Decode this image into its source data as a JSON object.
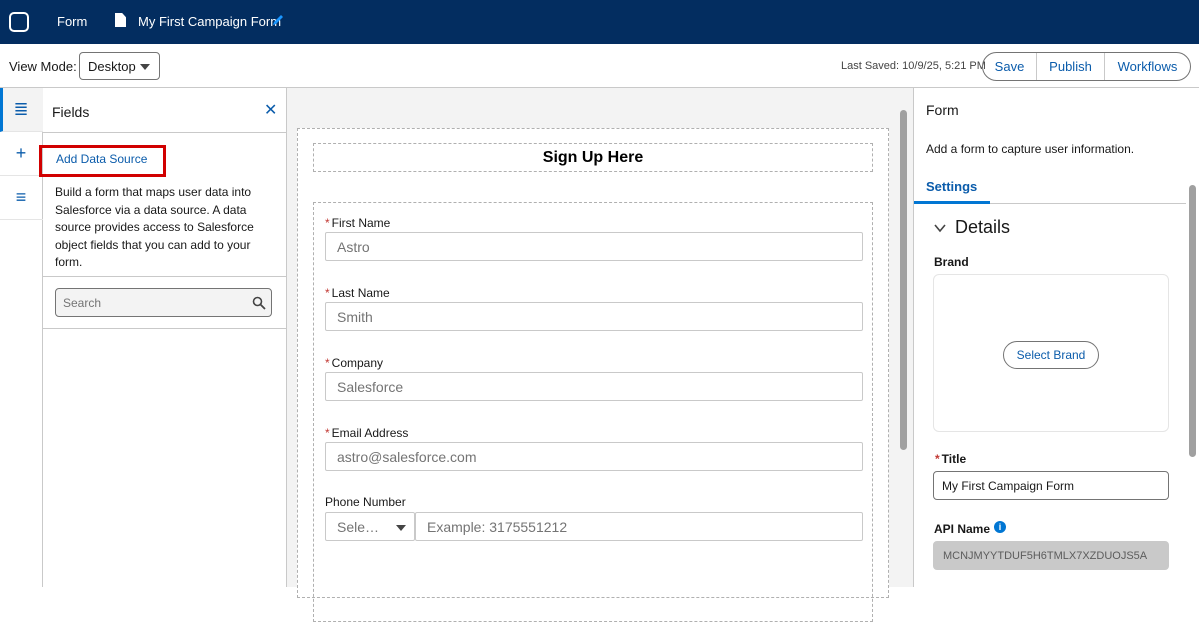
{
  "topbar": {
    "app_label": "Form",
    "form_title": "My First Campaign Form"
  },
  "toolbar": {
    "view_mode_label": "View Mode:",
    "view_mode_value": "Desktop",
    "last_saved": "Last Saved: 10/9/25, 5:21 PM",
    "save_label": "Save",
    "publish_label": "Publish",
    "workflows_label": "Workflows"
  },
  "rail": {
    "items": [
      {
        "icon": "fields-icon",
        "glyph": "≣"
      },
      {
        "icon": "add-icon",
        "glyph": "+"
      },
      {
        "icon": "list-icon",
        "glyph": "≡"
      }
    ]
  },
  "fields_panel": {
    "title": "Fields",
    "add_data_source": "Add Data Source",
    "description": "Build a form that maps user data into Salesforce via a data source. A data source provides access to Salesforce object fields that you can add to your form.",
    "search_placeholder": "Search"
  },
  "form": {
    "heading": "Sign Up Here",
    "fields": [
      {
        "label": "First Name",
        "required": "*",
        "placeholder": "Astro"
      },
      {
        "label": "Last Name",
        "required": "*",
        "placeholder": "Smith"
      },
      {
        "label": "Company",
        "required": "*",
        "placeholder": "Salesforce"
      },
      {
        "label": "Email Address",
        "required": "*",
        "placeholder": "astro@salesforce.com"
      }
    ],
    "phone": {
      "label": "Phone Number",
      "select_value": "Sele…",
      "placeholder": "Example: 3175551212"
    }
  },
  "right_panel": {
    "title": "Form",
    "description": "Add a form to capture user information.",
    "tab": "Settings",
    "section_title": "Details",
    "brand_label": "Brand",
    "select_brand": "Select Brand",
    "title_label": "Title",
    "title_required": "*",
    "title_value": "My First Campaign Form",
    "api_name_label": "API Name",
    "api_name_value": "MCNJMYYTDUF5H6TMLX7XZDUOJS5A"
  },
  "colors": {
    "topbar_bg": "#032d60",
    "accent": "#0176d3",
    "link": "#0b5cab",
    "highlight": "#d10000",
    "required": "#c23934"
  }
}
